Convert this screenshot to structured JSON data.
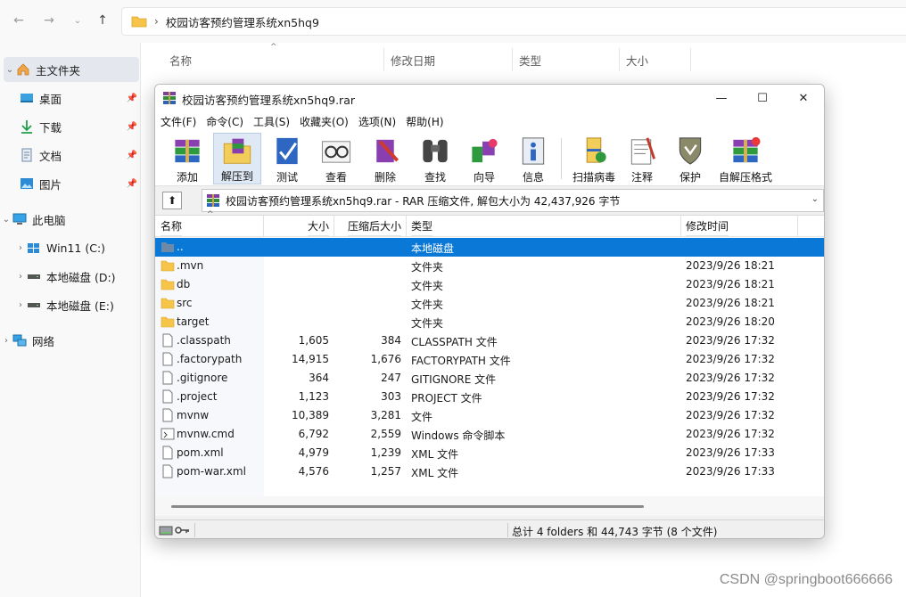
{
  "explorer": {
    "address": {
      "path_label": "校园访客预约管理系统xn5hq9"
    },
    "columns": [
      "名称",
      "修改日期",
      "类型",
      "大小"
    ],
    "sidebar": [
      {
        "label": "主文件夹",
        "icon": "home-icon"
      },
      {
        "label": "桌面",
        "icon": "desktop-icon"
      },
      {
        "label": "下载",
        "icon": "download-icon"
      },
      {
        "label": "文档",
        "icon": "document-icon"
      },
      {
        "label": "图片",
        "icon": "picture-icon"
      },
      {
        "label": "此电脑",
        "icon": "computer-icon"
      },
      {
        "label": "Win11 (C:)",
        "icon": "drive-c-icon"
      },
      {
        "label": "本地磁盘 (D:)",
        "icon": "drive-icon"
      },
      {
        "label": "本地磁盘 (E:)",
        "icon": "drive-icon"
      },
      {
        "label": "网络",
        "icon": "network-icon"
      }
    ]
  },
  "rar": {
    "title": "校园访客预约管理系统xn5hq9.rar",
    "menu": [
      "文件(F)",
      "命令(C)",
      "工具(S)",
      "收藏夹(O)",
      "选项(N)",
      "帮助(H)"
    ],
    "toolbar": [
      "添加",
      "解压到",
      "测试",
      "查看",
      "删除",
      "查找",
      "向导",
      "信息",
      "扫描病毒",
      "注释",
      "保护",
      "自解压格式"
    ],
    "path": "校园访客预约管理系统xn5hq9.rar - RAR 压缩文件, 解包大小为 42,437,926 字节",
    "columns": {
      "name": "名称",
      "size": "大小",
      "packed": "压缩后大小",
      "type": "类型",
      "modified": "修改时间"
    },
    "rows": [
      {
        "name": "..",
        "size": "",
        "packed": "",
        "type": "本地磁盘",
        "time": "",
        "icon": "parent-folder-icon"
      },
      {
        "name": ".mvn",
        "size": "",
        "packed": "",
        "type": "文件夹",
        "time": "2023/9/26 18:21",
        "icon": "folder-icon"
      },
      {
        "name": "db",
        "size": "",
        "packed": "",
        "type": "文件夹",
        "time": "2023/9/26 18:21",
        "icon": "folder-icon"
      },
      {
        "name": "src",
        "size": "",
        "packed": "",
        "type": "文件夹",
        "time": "2023/9/26 18:21",
        "icon": "folder-icon"
      },
      {
        "name": "target",
        "size": "",
        "packed": "",
        "type": "文件夹",
        "time": "2023/9/26 18:20",
        "icon": "folder-icon"
      },
      {
        "name": ".classpath",
        "size": "1,605",
        "packed": "384",
        "type": "CLASSPATH 文件",
        "time": "2023/9/26 17:32",
        "icon": "file-icon"
      },
      {
        "name": ".factorypath",
        "size": "14,915",
        "packed": "1,676",
        "type": "FACTORYPATH 文件",
        "time": "2023/9/26 17:32",
        "icon": "file-icon"
      },
      {
        "name": ".gitignore",
        "size": "364",
        "packed": "247",
        "type": "GITIGNORE 文件",
        "time": "2023/9/26 17:32",
        "icon": "file-icon"
      },
      {
        "name": ".project",
        "size": "1,123",
        "packed": "303",
        "type": "PROJECT 文件",
        "time": "2023/9/26 17:32",
        "icon": "file-icon"
      },
      {
        "name": "mvnw",
        "size": "10,389",
        "packed": "3,281",
        "type": "文件",
        "time": "2023/9/26 17:32",
        "icon": "file-icon"
      },
      {
        "name": "mvnw.cmd",
        "size": "6,792",
        "packed": "2,559",
        "type": "Windows 命令脚本",
        "time": "2023/9/26 17:32",
        "icon": "script-file-icon"
      },
      {
        "name": "pom.xml",
        "size": "4,979",
        "packed": "1,239",
        "type": "XML 文件",
        "time": "2023/9/26 17:33",
        "icon": "file-icon"
      },
      {
        "name": "pom-war.xml",
        "size": "4,576",
        "packed": "1,257",
        "type": "XML 文件",
        "time": "2023/9/26 17:33",
        "icon": "file-icon"
      }
    ],
    "status": "总计 4 folders 和 44,743 字节 (8 个文件)"
  },
  "watermark": "CSDN @springboot666666",
  "colors": {
    "selection": "#0a78d7",
    "folder": "#f7c44a",
    "accent": "#0078d4"
  }
}
